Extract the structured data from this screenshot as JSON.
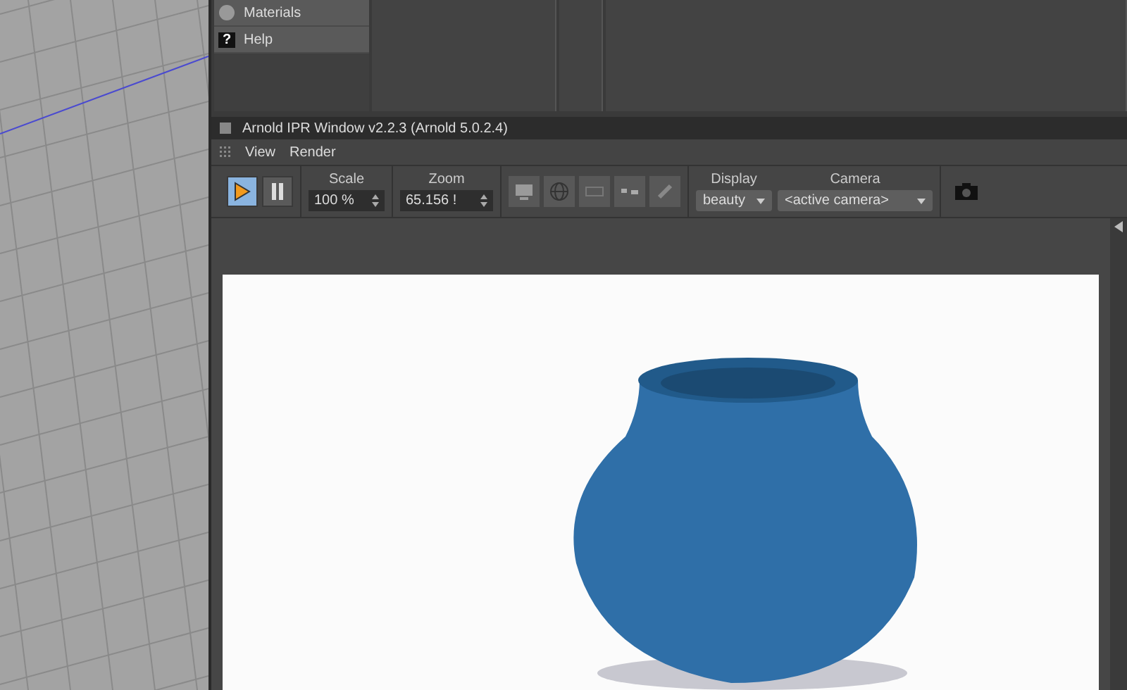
{
  "menu_list": {
    "items": [
      {
        "kind": "sphere",
        "label": "Materials"
      },
      {
        "kind": "help",
        "label": "Help",
        "icon_text": "?"
      }
    ]
  },
  "window": {
    "title": "Arnold IPR Window v2.2.3 (Arnold 5.0.2.4)"
  },
  "menu_bar": [
    "View",
    "Render"
  ],
  "toolbar": {
    "transport": [
      {
        "kind": "play",
        "selected": true
      },
      {
        "kind": "pause",
        "selected": false
      }
    ],
    "scale": {
      "label": "Scale",
      "value": "100 %"
    },
    "zoom": {
      "label": "Zoom",
      "value": "65.156 !"
    },
    "view_buttons": [
      {
        "kind": "monitor"
      },
      {
        "kind": "globe"
      },
      {
        "kind": "region"
      },
      {
        "kind": "split"
      },
      {
        "kind": "eyedropper"
      }
    ],
    "display": {
      "label": "Display",
      "value": "beauty"
    },
    "camera": {
      "label": "Camera",
      "value": "<active camera>"
    }
  }
}
